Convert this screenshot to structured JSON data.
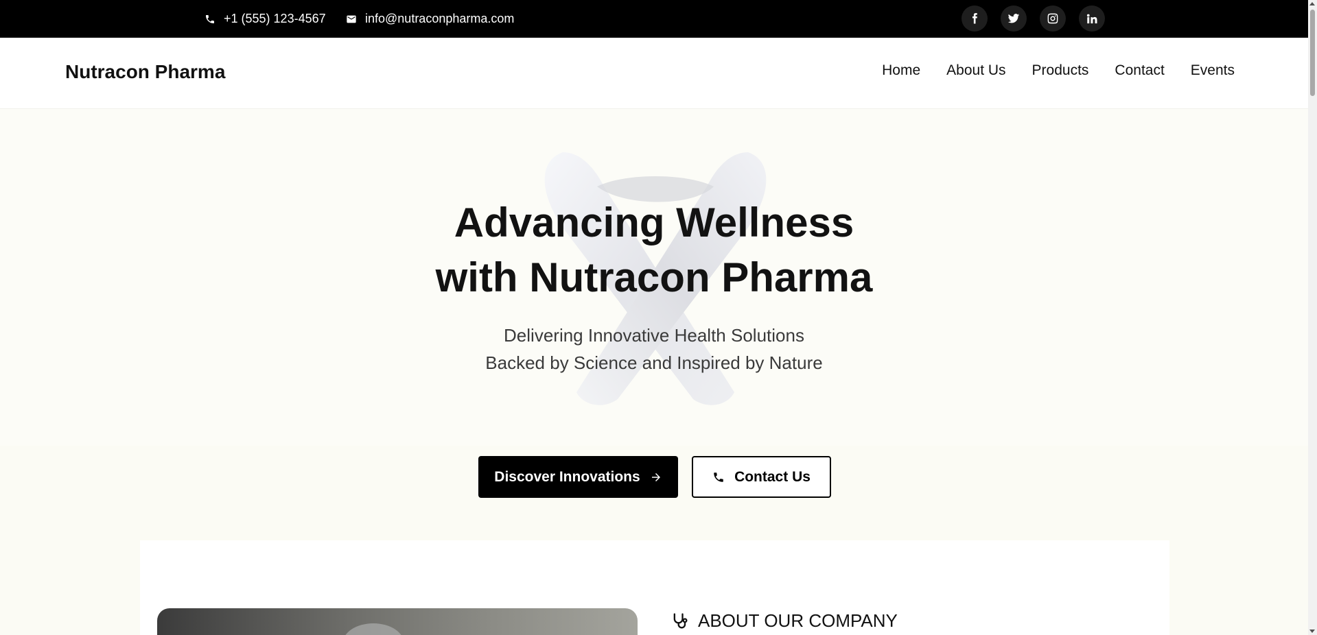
{
  "topbar": {
    "phone": "+1 (555) 123-4567",
    "email": "info@nutraconpharma.com",
    "socials": [
      {
        "name": "facebook",
        "icon": "facebook-icon"
      },
      {
        "name": "twitter",
        "icon": "twitter-icon"
      },
      {
        "name": "instagram",
        "icon": "instagram-icon"
      },
      {
        "name": "linkedin",
        "icon": "linkedin-icon"
      }
    ]
  },
  "header": {
    "brand": "Nutracon Pharma",
    "nav": [
      "Home",
      "About Us",
      "Products",
      "Contact",
      "Events"
    ]
  },
  "hero": {
    "title_line1": "Advancing Wellness",
    "title_line2": "with Nutracon Pharma",
    "subtitle_line1": "Delivering Innovative Health Solutions",
    "subtitle_line2": "Backed by Science and Inspired by Nature",
    "primary_button": "Discover Innovations",
    "secondary_button": "Contact Us"
  },
  "about": {
    "heading": "ABOUT OUR COMPANY"
  },
  "colors": {
    "topbar_bg": "#000000",
    "hero_bg": "#fcfcf7",
    "primary_btn_bg": "#000000",
    "text": "#111111"
  }
}
